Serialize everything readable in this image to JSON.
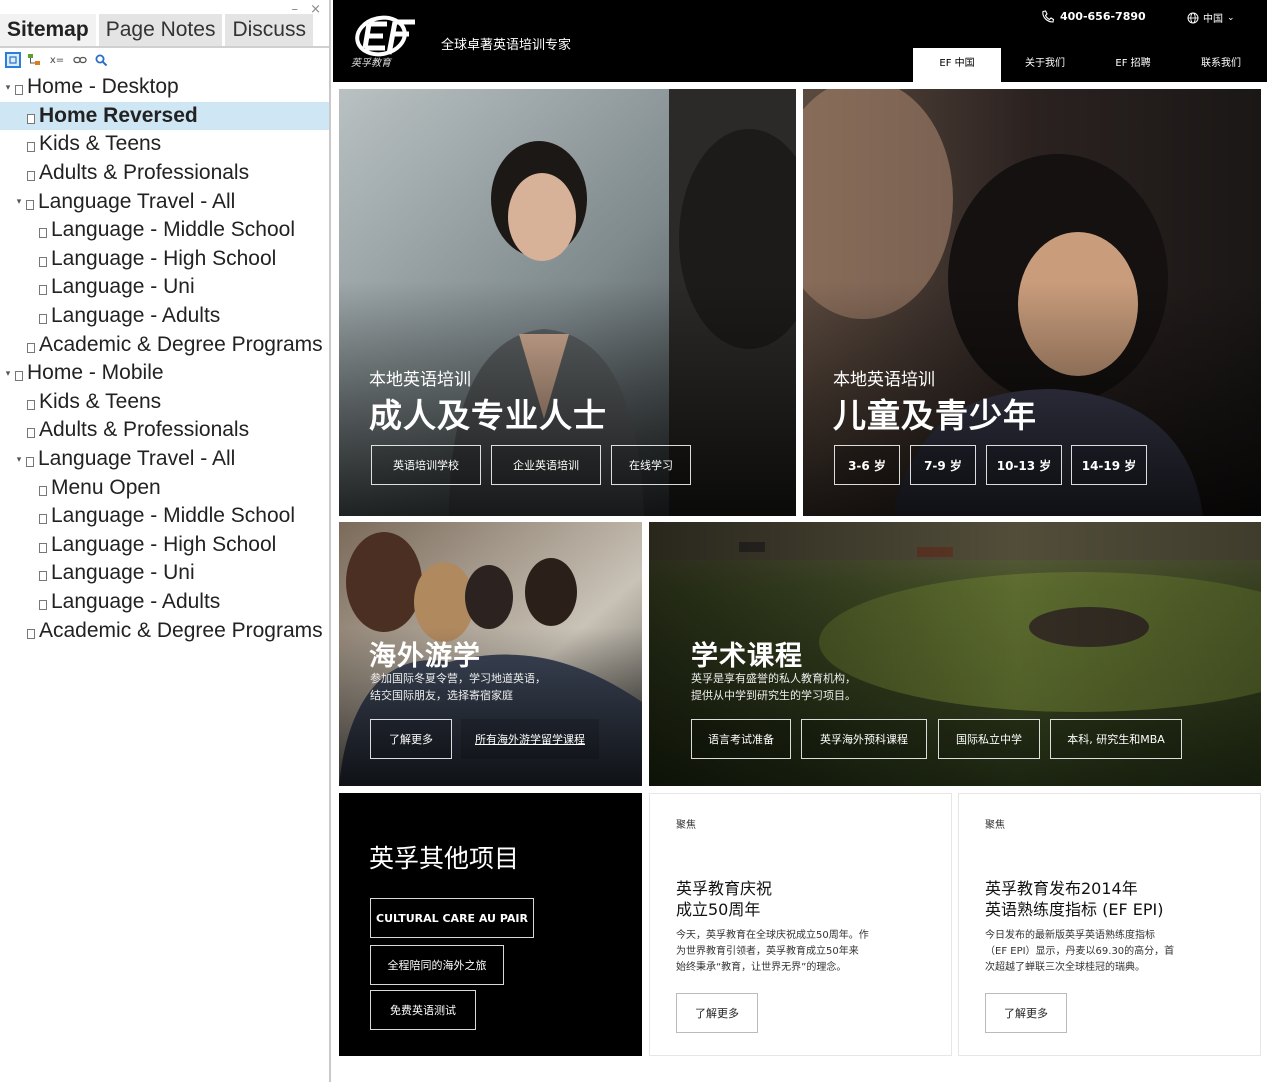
{
  "sitemap": {
    "tabs": [
      "Sitemap",
      "Page Notes",
      "Discuss"
    ],
    "window_controls": "– ×",
    "toolbar": {
      "filter_label": "x="
    },
    "tree": [
      {
        "label": "Home - Desktop",
        "level": 0,
        "expanded": true
      },
      {
        "label": "Home Reversed",
        "level": 1,
        "selected": true
      },
      {
        "label": "Kids & Teens",
        "level": 1
      },
      {
        "label": "Adults & Professionals",
        "level": 1
      },
      {
        "label": "Language Travel - All",
        "level": 1,
        "expanded": true
      },
      {
        "label": "Language - Middle School",
        "level": 2
      },
      {
        "label": "Language - High School",
        "level": 2
      },
      {
        "label": "Language - Uni",
        "level": 2
      },
      {
        "label": "Language - Adults",
        "level": 2
      },
      {
        "label": "Academic & Degree Programs",
        "level": 1
      },
      {
        "label": "Home - Mobile",
        "level": 0,
        "expanded": true
      },
      {
        "label": "Kids & Teens",
        "level": 1
      },
      {
        "label": "Adults & Professionals",
        "level": 1
      },
      {
        "label": "Language Travel - All",
        "level": 1,
        "expanded": true
      },
      {
        "label": "Menu Open",
        "level": 2
      },
      {
        "label": "Language - Middle School",
        "level": 2
      },
      {
        "label": "Language - High School",
        "level": 2
      },
      {
        "label": "Language - Uni",
        "level": 2
      },
      {
        "label": "Language - Adults",
        "level": 2
      },
      {
        "label": "Academic & Degree Programs",
        "level": 1
      }
    ]
  },
  "site": {
    "logo_text": "英孚教育",
    "tagline": "全球卓著英语培训专家",
    "phone": "400-656-7890",
    "language": "中国",
    "nav": [
      "EF 中国",
      "关于我们",
      "EF 招聘",
      "联系我们"
    ],
    "adults": {
      "kicker": "本地英语培训",
      "title": "成人及专业人士",
      "buttons": [
        "英语培训学校",
        "企业英语培训",
        "在线学习"
      ]
    },
    "kids": {
      "kicker": "本地英语培训",
      "title": "儿童及青少年",
      "buttons": [
        "3-6 岁",
        "7-9 岁",
        "10-13 岁",
        "14-19 岁"
      ]
    },
    "travel": {
      "title": "海外游学",
      "desc_line1": "参加国际冬夏令营，学习地道英语，",
      "desc_line2": "结交国际朋友，选择寄宿家庭",
      "buttons": [
        "了解更多",
        "所有海外游学留学课程"
      ]
    },
    "academic": {
      "title": "学术课程",
      "desc_line1": "英孚是享有盛誉的私人教育机构，",
      "desc_line2": "提供从中学到研究生的学习项目。",
      "buttons": [
        "语言考试准备",
        "英孚海外预科课程",
        "国际私立中学",
        "本科, 研究生和MBA"
      ]
    },
    "other": {
      "title": "英孚其他项目",
      "buttons": [
        "CULTURAL CARE AU PAIR",
        "全程陪同的海外之旅",
        "免费英语测试"
      ]
    },
    "news1": {
      "kicker": "聚焦",
      "title_line1": "英孚教育庆祝",
      "title_line2": "成立50周年",
      "body_line1": "今天，英孚教育在全球庆祝成立50周年。作",
      "body_line2": "为世界教育引领者，英孚教育成立50年来",
      "body_line3": "始终秉承“教育，让世界无界”的理念。",
      "button": "了解更多"
    },
    "news2": {
      "kicker": "聚焦",
      "title_line1": "英孚教育发布2014年",
      "title_line2": "英语熟练度指标 (EF EPI)",
      "body_line1": "今日发布的最新版英孚英语熟练度指标",
      "body_line2": "（EF EPI）显示，丹麦以69.30的高分，首",
      "body_line3": "次超越了蝉联三次全球桂冠的瑞典。",
      "button": "了解更多"
    }
  }
}
